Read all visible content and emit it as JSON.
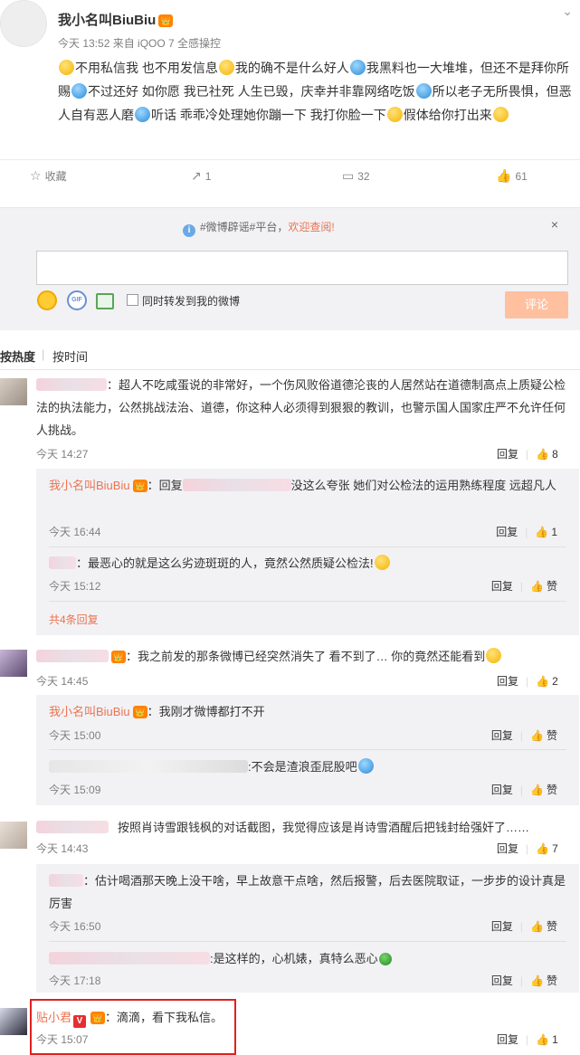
{
  "post": {
    "author": "我小名叫BiuBiu",
    "vip_mark": "👑",
    "meta": "今天 13:52 来自 iQOO 7 全感操控",
    "body_segments": [
      "不用私信我 也不用发信息",
      "我的确不是什么好人",
      "我黑料也一大堆堆，但还不是拜你所赐",
      "不过还好 如你愿 我已社死 人生已毁，庆幸并非靠网络吃饭",
      "所以老子无所畏惧，但恶人自有恶人磨",
      "听话 乖乖冷处理她你蹦一下 我打你脸一下",
      "假体给你打出来"
    ]
  },
  "actions": {
    "favorite_icon": "☆",
    "favorite": "收藏",
    "repost_icon": "↗",
    "repost": "1",
    "comment_icon": "▭",
    "comment": "32",
    "like_icon": "👍",
    "like": "61"
  },
  "rumor": {
    "text": "#微博辟谣#平台，",
    "link": "欢迎查阅!",
    "close": "×"
  },
  "composer": {
    "forward_label": "同时转发到我的微博",
    "submit": "评论",
    "gif_label": "GIF"
  },
  "sort": {
    "hot": "按热度",
    "time": "按时间"
  },
  "common": {
    "reply": "回复",
    "zan": "赞",
    "thumb": "👍",
    "vip": "👑",
    "colon": "："
  },
  "comments": [
    {
      "text": "：超人不吃咸蛋说的非常好，一个伤风败俗道德沦丧的人居然站在道德制高点上质疑公检法的执法能力，公然挑战法治、道德，你这种人必须得到狠狠的教训，也警示国人国家庄严不允许任何人挑战。",
      "time": "今天 14:27",
      "likes": "8",
      "subs": [
        {
          "name": "我小名叫BiuBiu",
          "prefix": "：回复",
          "text": "没这么夸张  她们对公检法的运用熟练程度 远超凡人",
          "time": "今天 16:44",
          "likes": "1"
        },
        {
          "name": "",
          "prefix": "",
          "text": "：最恶心的就是这么劣迹斑斑的人，竟然公然质疑公检法!",
          "time": "今天 15:12",
          "likes": "赞"
        }
      ],
      "more": "共4条回复"
    },
    {
      "text": "：我之前发的那条微博已经突然消失了 看不到了… 你的竟然还能看到",
      "time": "今天 14:45",
      "likes": "2",
      "subs": [
        {
          "name": "我小名叫BiuBiu",
          "prefix": "",
          "text": "：我刚才微博都打不开",
          "time": "今天 15:00",
          "likes": "赞"
        },
        {
          "name": "",
          "prefix": "",
          "text": ":不会是渣浪歪屁股吧",
          "time": "今天 15:09",
          "likes": "赞"
        }
      ]
    },
    {
      "text": "按照肖诗雪跟钱枫的对话截图，我觉得应该是肖诗雪酒醒后把钱封给强奸了……",
      "time": "今天 14:43",
      "likes": "7",
      "subs": [
        {
          "name": "",
          "prefix": "",
          "text": "：估计喝酒那天晚上没干啥，早上故意干点啥，然后报警，后去医院取证，一步步的设计真是厉害",
          "time": "今天 16:50",
          "likes": "赞"
        },
        {
          "name": "",
          "prefix": "",
          "text": ":是这样的，心机婊，真特么恶心",
          "time": "今天 17:18",
          "likes": "赞"
        }
      ]
    },
    {
      "name": "贴小君",
      "v": "V",
      "text": "：滴滴，看下我私信。",
      "time": "今天 15:07",
      "likes": "1"
    }
  ]
}
